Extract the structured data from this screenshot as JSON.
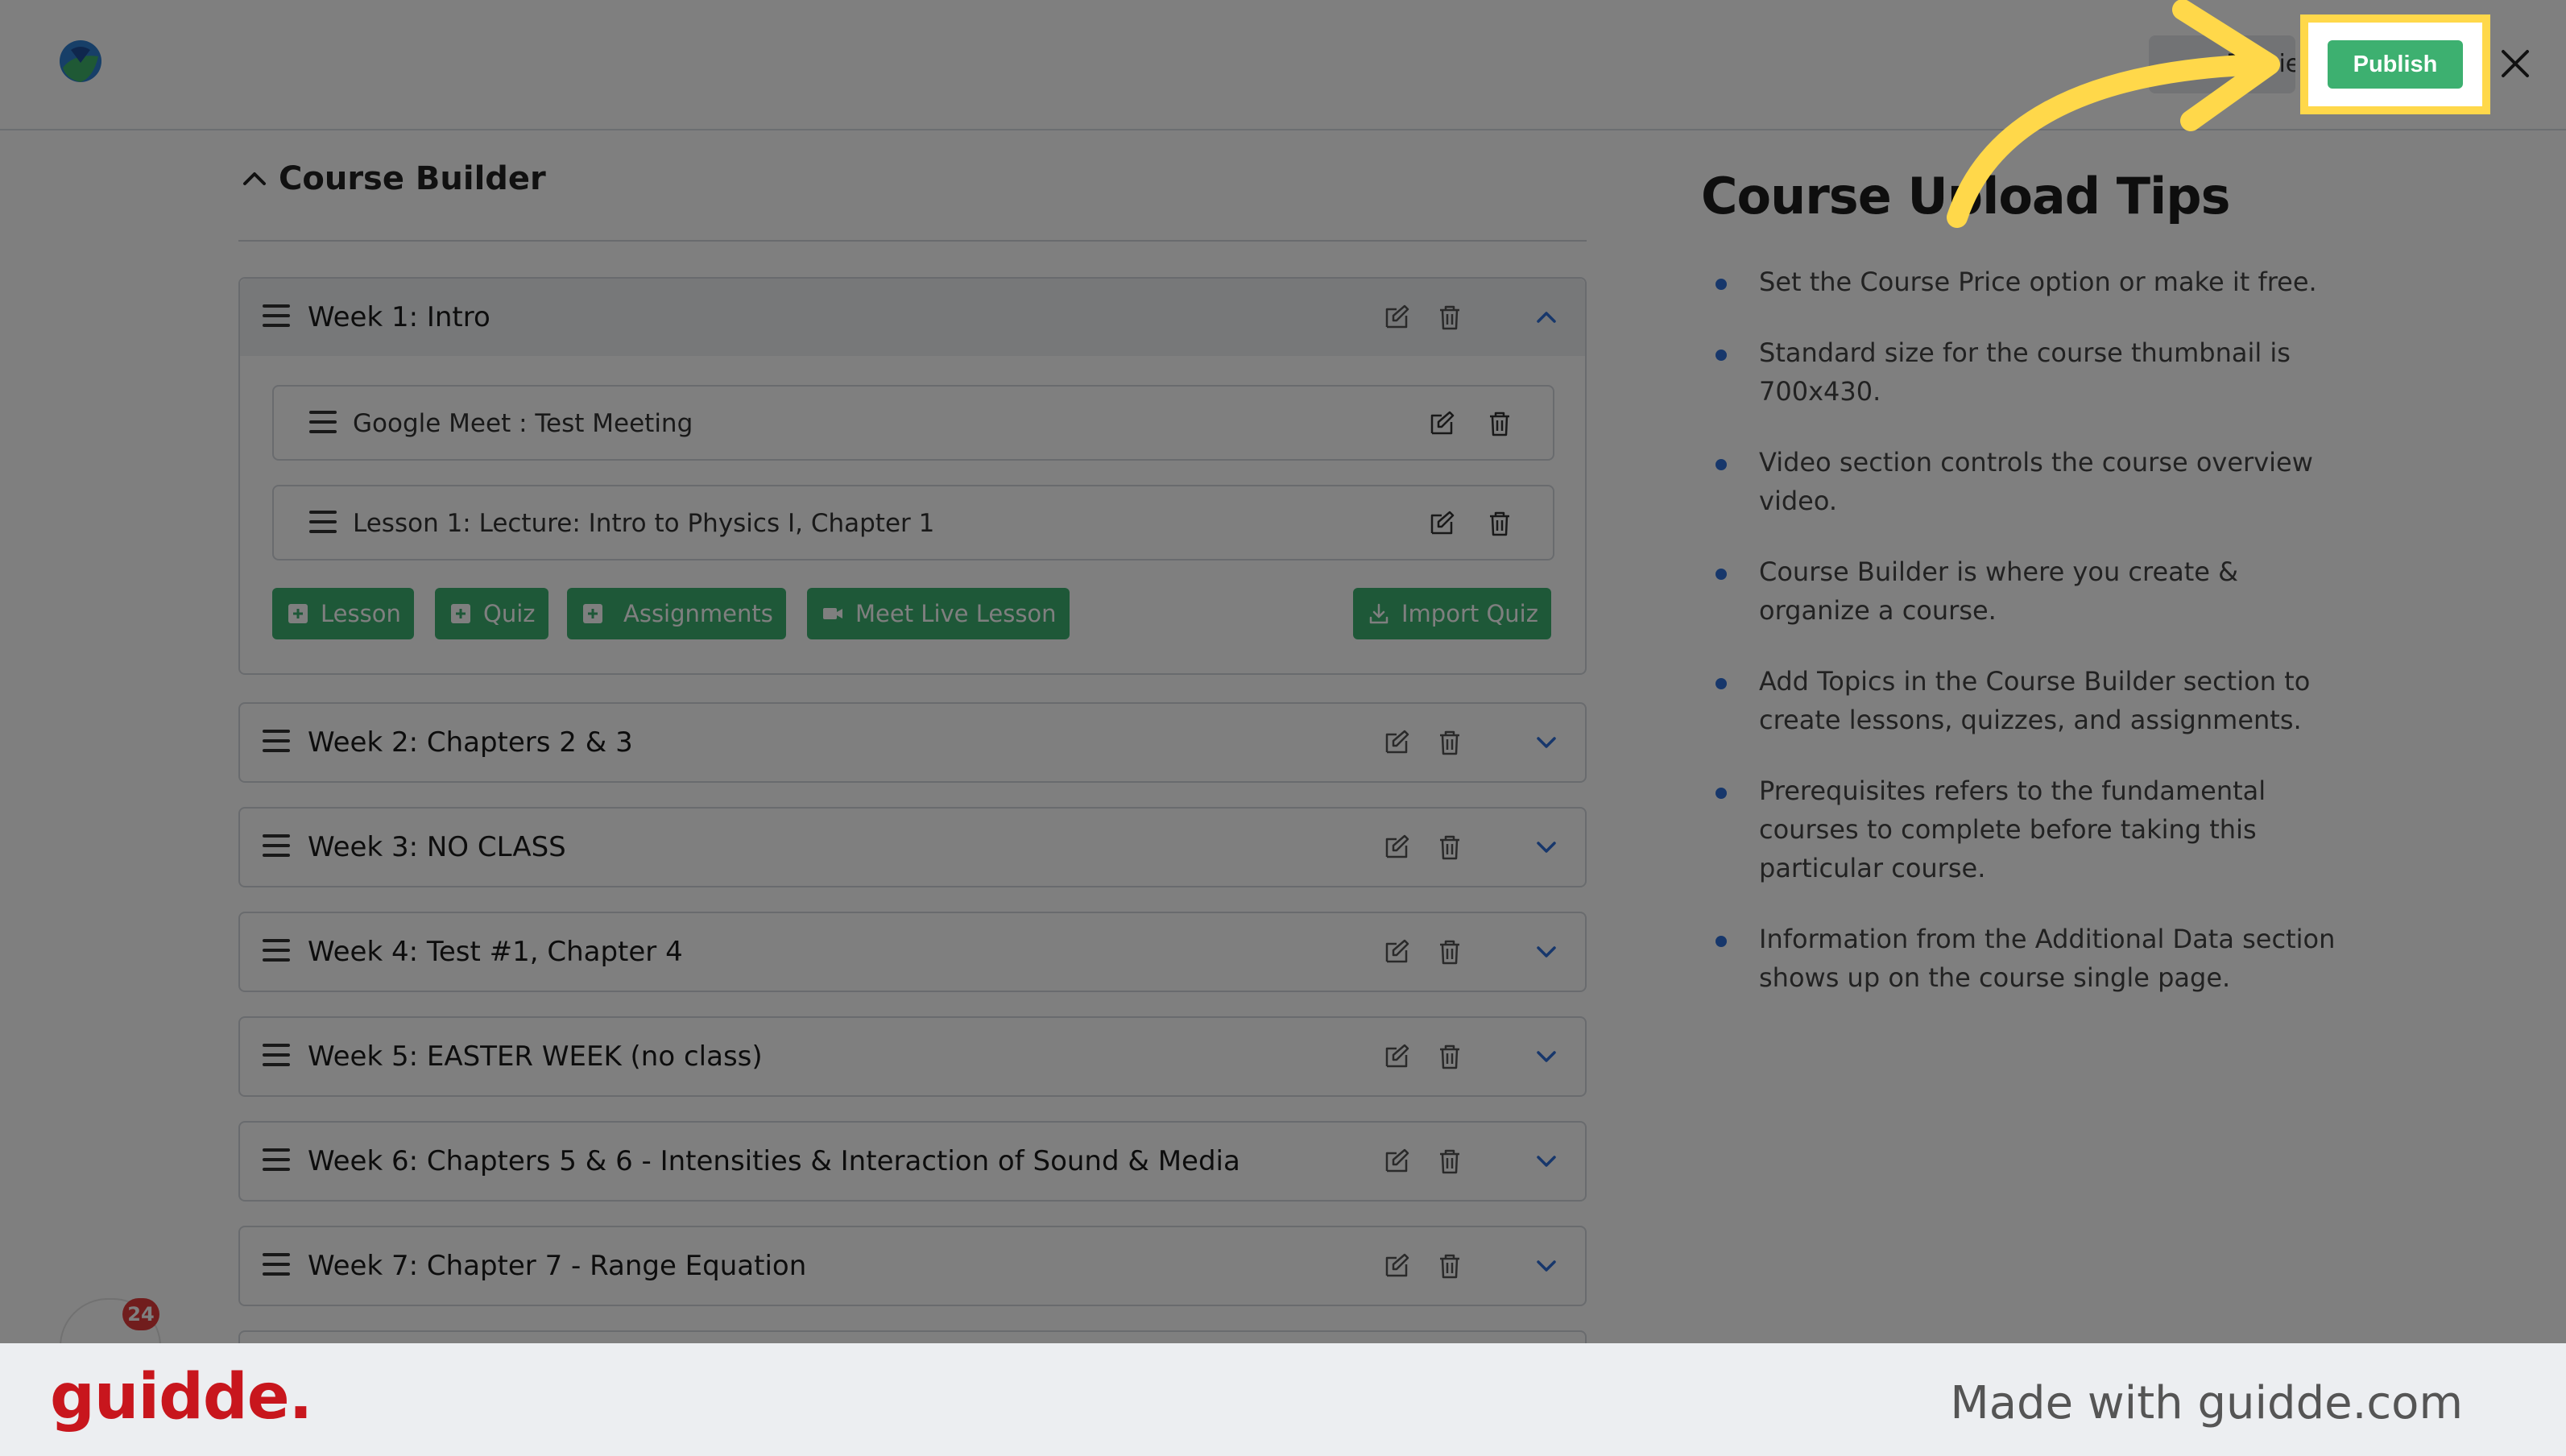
{
  "header": {
    "preview_label": "Preview",
    "publish_label": "Publish"
  },
  "course_builder": {
    "title": "Course Builder",
    "topics": [
      {
        "title": "Week 1: Intro",
        "expanded": true,
        "lessons": [
          "Google Meet : Test Meeting",
          "Lesson 1: Lecture: Intro to Physics I, Chapter 1"
        ],
        "actions": [
          "Lesson",
          "Quiz",
          "Assignments",
          "Meet Live Lesson",
          "Import Quiz"
        ]
      },
      {
        "title": "Week 2: Chapters 2 & 3"
      },
      {
        "title": "Week 3: NO CLASS"
      },
      {
        "title": "Week 4: Test #1, Chapter 4"
      },
      {
        "title": "Week 5: EASTER WEEK (no class)"
      },
      {
        "title": "Week 6: Chapters 5 & 6 - Intensities & Interaction of Sound & Media"
      },
      {
        "title": "Week 7: Chapter 7 - Range Equation"
      }
    ]
  },
  "tips": {
    "title": "Course Upload Tips",
    "items": [
      "Set the Course Price option or make it free.",
      "Standard size for the course thumbnail is 700x430.",
      "Video section controls the course overview video.",
      "Course Builder is where you create & organize a course.",
      "Add Topics in the Course Builder section to create lessons, quizzes, and assignments.",
      "Prerequisites refers to the fundamental courses to complete before taking this particular course.",
      "Information from the Additional Data section shows up on the course single page."
    ]
  },
  "chat": {
    "badge_count": "24"
  },
  "footer": {
    "brand": "guidde.",
    "made_with": "Made with guidde.com"
  },
  "colors": {
    "accent_green": "#3db070",
    "highlight_yellow": "#ffd84a",
    "brand_red": "#c8161d",
    "chevron_blue": "#2f6fd6"
  }
}
